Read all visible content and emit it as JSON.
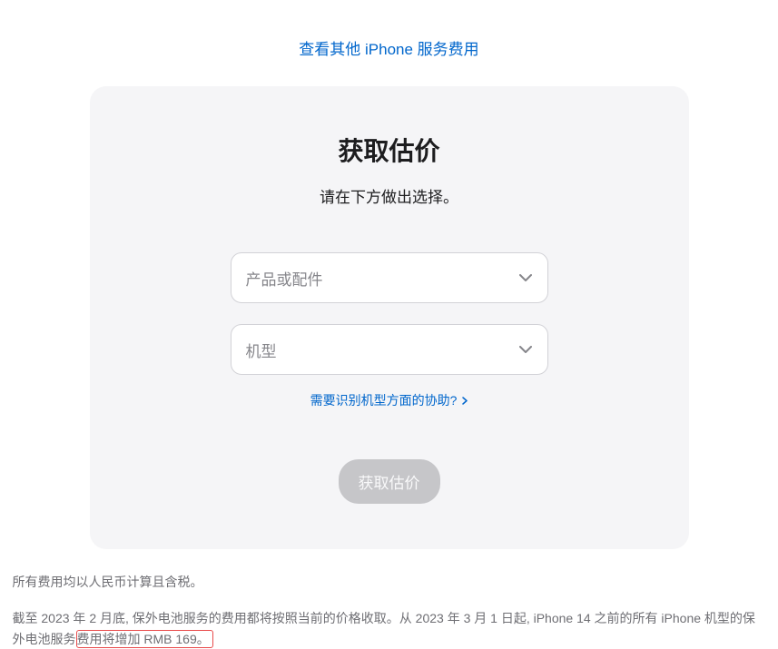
{
  "top_link": {
    "label": "查看其他 iPhone 服务费用"
  },
  "card": {
    "title": "获取估价",
    "subtitle": "请在下方做出选择。",
    "select1_placeholder": "产品或配件",
    "select2_placeholder": "机型",
    "help_link": "需要识别机型方面的协助?",
    "submit_label": "获取估价"
  },
  "footer": {
    "note1": "所有费用均以人民币计算且含税。",
    "note2_part1": "截至 2023 年 2 月底, 保外电池服务的费用都将按照当前的价格收取。从 2023 年 3 月 1 日起, iPhone 14 之前的所有 iPhone 机型的保外电池服务",
    "note2_highlight": "费用将增加 RMB 169。"
  }
}
